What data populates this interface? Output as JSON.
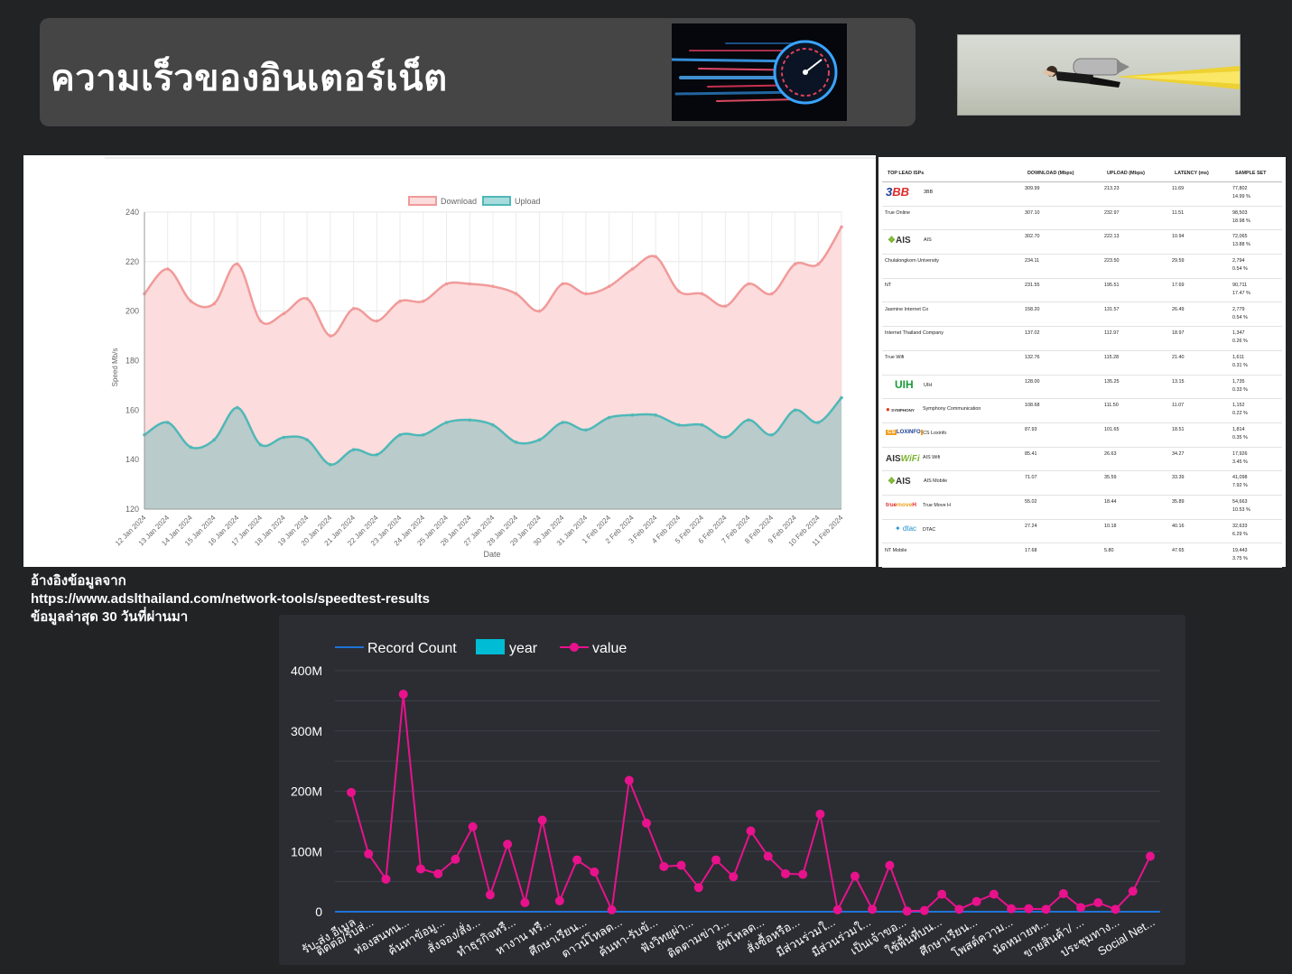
{
  "header": {
    "title": "ความเร็วของอินเตอร์เน็ต",
    "speed_image": "speedometer-motion-image",
    "hero_image": "flying-businessman-rocket-image"
  },
  "chart_data": [
    {
      "type": "area",
      "legend": [
        "Download",
        "Upload"
      ],
      "legend_position": "top",
      "xlabel": "Date",
      "ylabel": "Speed Mb/s",
      "ylim": [
        120,
        240
      ],
      "yticks": [
        120,
        140,
        160,
        180,
        200,
        220,
        240
      ],
      "grid": true,
      "categories": [
        "12 Jan 2024",
        "13 Jan 2024",
        "14 Jan 2024",
        "15 Jan 2024",
        "16 Jan 2024",
        "17 Jan 2024",
        "18 Jan 2024",
        "19 Jan 2024",
        "20 Jan 2024",
        "21 Jan 2024",
        "22 Jan 2024",
        "23 Jan 2024",
        "24 Jan 2024",
        "25 Jan 2024",
        "26 Jan 2024",
        "27 Jan 2024",
        "28 Jan 2024",
        "29 Jan 2024",
        "30 Jan 2024",
        "31 Jan 2024",
        "1 Feb 2024",
        "2 Feb 2024",
        "3 Feb 2024",
        "4 Feb 2024",
        "5 Feb 2024",
        "6 Feb 2024",
        "7 Feb 2024",
        "8 Feb 2024",
        "9 Feb 2024",
        "10 Feb 2024",
        "11 Feb 2024"
      ],
      "series": [
        {
          "name": "Download",
          "color": "#f19a9a",
          "fill": "#fcdcdc",
          "values": [
            207,
            217,
            204,
            203,
            219,
            196,
            199,
            205,
            190,
            201,
            196,
            204,
            204,
            211,
            211,
            210,
            207,
            200,
            211,
            207,
            210,
            217,
            222,
            208,
            207,
            202,
            211,
            207,
            219,
            219,
            234
          ]
        },
        {
          "name": "Upload",
          "color": "#4fb8b8",
          "fill": "#b5c9c8",
          "values": [
            150,
            155,
            145,
            148,
            161,
            146,
            149,
            148,
            138,
            144,
            142,
            150,
            150,
            155,
            156,
            154,
            147,
            148,
            155,
            152,
            157,
            158,
            158,
            154,
            154,
            149,
            156,
            150,
            160,
            155,
            165
          ]
        }
      ]
    },
    {
      "type": "line",
      "legend": [
        "Record Count",
        "year",
        "value"
      ],
      "legend_position": "top-left",
      "ylim": [
        0,
        400000000
      ],
      "yticks": [
        "0",
        "100M",
        "200M",
        "300M",
        "400M"
      ],
      "grid": true,
      "categories": [
        "รับ-ส่ง อีเมล",
        "ติดต่อ/รับส่...",
        "",
        "ท่องสนทน...",
        "",
        "ค้นหาข้อมู...",
        "",
        "สั่งจอง/สั่ง...",
        "",
        "ทำธุรกิจหรื...",
        "",
        "หางาน หรื...",
        "",
        "ศึกษาเรียน...",
        "",
        "ดาวน์โหลด...",
        "",
        "ค้นหา-รับข้...",
        "",
        "ฟังวิทยุผ่า...",
        "",
        "ติดตามข่าว...",
        "",
        "อัพโหลด...",
        "",
        "สั่งซื้อหรือ...",
        "",
        "มีส่วนร่วมใ...",
        "",
        "มีส่วนร่วมใ...",
        "",
        "เป็นเจ้าขอ...",
        "",
        "ใช้พื้นที่บน...",
        "",
        "ศึกษาเรียน...",
        "",
        "โพสต์ความ...",
        "",
        "นัดหมายท...",
        "",
        "ขายสินค้า/ ...",
        "",
        "ประชุมทาง...",
        "",
        "Social Net..."
      ],
      "series": [
        {
          "name": "Record Count",
          "color": "#1e73d8",
          "values": [
            0,
            0,
            0,
            0,
            0,
            0,
            0,
            0,
            0,
            0,
            0,
            0,
            0,
            0,
            0,
            0,
            0,
            0,
            0,
            0,
            0,
            0,
            0,
            0,
            0,
            0,
            0,
            0,
            0,
            0,
            0,
            0,
            0,
            0,
            0,
            0,
            0,
            0,
            0,
            0,
            0,
            0,
            0,
            0,
            0,
            0,
            0,
            0,
            0
          ]
        },
        {
          "name": "year",
          "color": "#00bcd4",
          "values": [
            0,
            0,
            0,
            0,
            0,
            0,
            0,
            0,
            0,
            0,
            0,
            0,
            0,
            0,
            0,
            0,
            0,
            0,
            0,
            0,
            0,
            0,
            0,
            0,
            0,
            0,
            0,
            0,
            0,
            0,
            0,
            0,
            0,
            0,
            0,
            0,
            0,
            0,
            0,
            0,
            0,
            0,
            0,
            0,
            0,
            0,
            0,
            0,
            0
          ]
        },
        {
          "name": "value",
          "color": "#e8128c",
          "values": [
            198000000,
            96000000,
            54000000,
            361000000,
            71000000,
            63000000,
            87000000,
            141000000,
            28000000,
            112000000,
            15000000,
            152000000,
            18000000,
            86000000,
            66000000,
            3000000,
            218000000,
            147000000,
            75000000,
            77000000,
            40000000,
            86000000,
            58000000,
            134000000,
            92000000,
            63000000,
            62000000,
            162000000,
            3000000,
            59000000,
            4000000,
            77000000,
            1000000,
            2000000,
            29000000,
            4000000,
            17000000,
            29000000,
            5000000,
            5000000,
            4000000,
            30000000,
            7000000,
            15000000,
            4000000,
            34000000,
            92000000
          ]
        }
      ]
    }
  ],
  "isp_table": {
    "headers": [
      "TOP LEAD ISPs",
      "DOWNLOAD (Mbps)",
      "UPLOAD (Mbps)",
      "LATENCY (ms)",
      "SAMPLE SET"
    ],
    "rows": [
      {
        "logo": "3BB",
        "name": "3BB",
        "download": "309.99",
        "upload": "213.23",
        "latency": "11.69",
        "sample": "77,802",
        "pct": "14.99 %"
      },
      {
        "logo": "",
        "name": "True Online",
        "download": "307.10",
        "upload": "232.97",
        "latency": "11.51",
        "sample": "98,503",
        "pct": "18.98 %"
      },
      {
        "logo": "AIS",
        "name": "AIS",
        "download": "302.70",
        "upload": "222.13",
        "latency": "10.94",
        "sample": "72,065",
        "pct": "13.88 %"
      },
      {
        "logo": "",
        "name": "Chulalongkorn University",
        "download": "234.11",
        "upload": "223.50",
        "latency": "29.59",
        "sample": "2,794",
        "pct": "0.54 %"
      },
      {
        "logo": "",
        "name": "NT",
        "download": "231.55",
        "upload": "195.51",
        "latency": "17.69",
        "sample": "90,711",
        "pct": "17.47 %"
      },
      {
        "logo": "",
        "name": "Jasmine Internet Co",
        "download": "158.20",
        "upload": "131.57",
        "latency": "26.49",
        "sample": "2,779",
        "pct": "0.54 %"
      },
      {
        "logo": "",
        "name": "Internet Thailand Company",
        "download": "137.02",
        "upload": "112.97",
        "latency": "18.97",
        "sample": "1,347",
        "pct": "0.26 %"
      },
      {
        "logo": "",
        "name": "True Wifi",
        "download": "132.76",
        "upload": "115.28",
        "latency": "21.40",
        "sample": "1,611",
        "pct": "0.31 %"
      },
      {
        "logo": "UIH",
        "name": "UIH",
        "download": "128.00",
        "upload": "135.25",
        "latency": "13.15",
        "sample": "1,735",
        "pct": "0.33 %"
      },
      {
        "logo": "SYMPHONY",
        "name": "Symphony Communication",
        "download": "108.68",
        "upload": "111.50",
        "latency": "11.07",
        "sample": "1,152",
        "pct": "0.22 %"
      },
      {
        "logo": "CSLOXINFO",
        "name": "CS Loxinfo",
        "download": "87.93",
        "upload": "101.65",
        "latency": "18.51",
        "sample": "1,814",
        "pct": "0.35 %"
      },
      {
        "logo": "AISWiFi",
        "name": "AIS Wifi",
        "download": "85.41",
        "upload": "26.63",
        "latency": "34.27",
        "sample": "17,926",
        "pct": "3.45 %"
      },
      {
        "logo": "AIS",
        "name": "AIS Mobile",
        "download": "71.07",
        "upload": "35.59",
        "latency": "33.39",
        "sample": "41,098",
        "pct": "7.92 %"
      },
      {
        "logo": "truemove H",
        "name": "True Move H",
        "download": "55.02",
        "upload": "18.44",
        "latency": "35.89",
        "sample": "54,663",
        "pct": "10.53 %"
      },
      {
        "logo": "dtac",
        "name": "DTAC",
        "download": "27.24",
        "upload": "10.18",
        "latency": "40.16",
        "sample": "32,633",
        "pct": "6.29 %"
      },
      {
        "logo": "",
        "name": "NT Mobile",
        "download": "17.68",
        "upload": "5.80",
        "latency": "47.65",
        "sample": "19,443",
        "pct": "3.75 %"
      }
    ]
  },
  "reference": {
    "line1": "อ้างอิงข้อมูลจาก",
    "line2": "https://www.adslthailand.com/network-tools/speedtest-results",
    "line3": "ข้อมูลล่าสุด 30 วันที่ผ่านมา"
  }
}
